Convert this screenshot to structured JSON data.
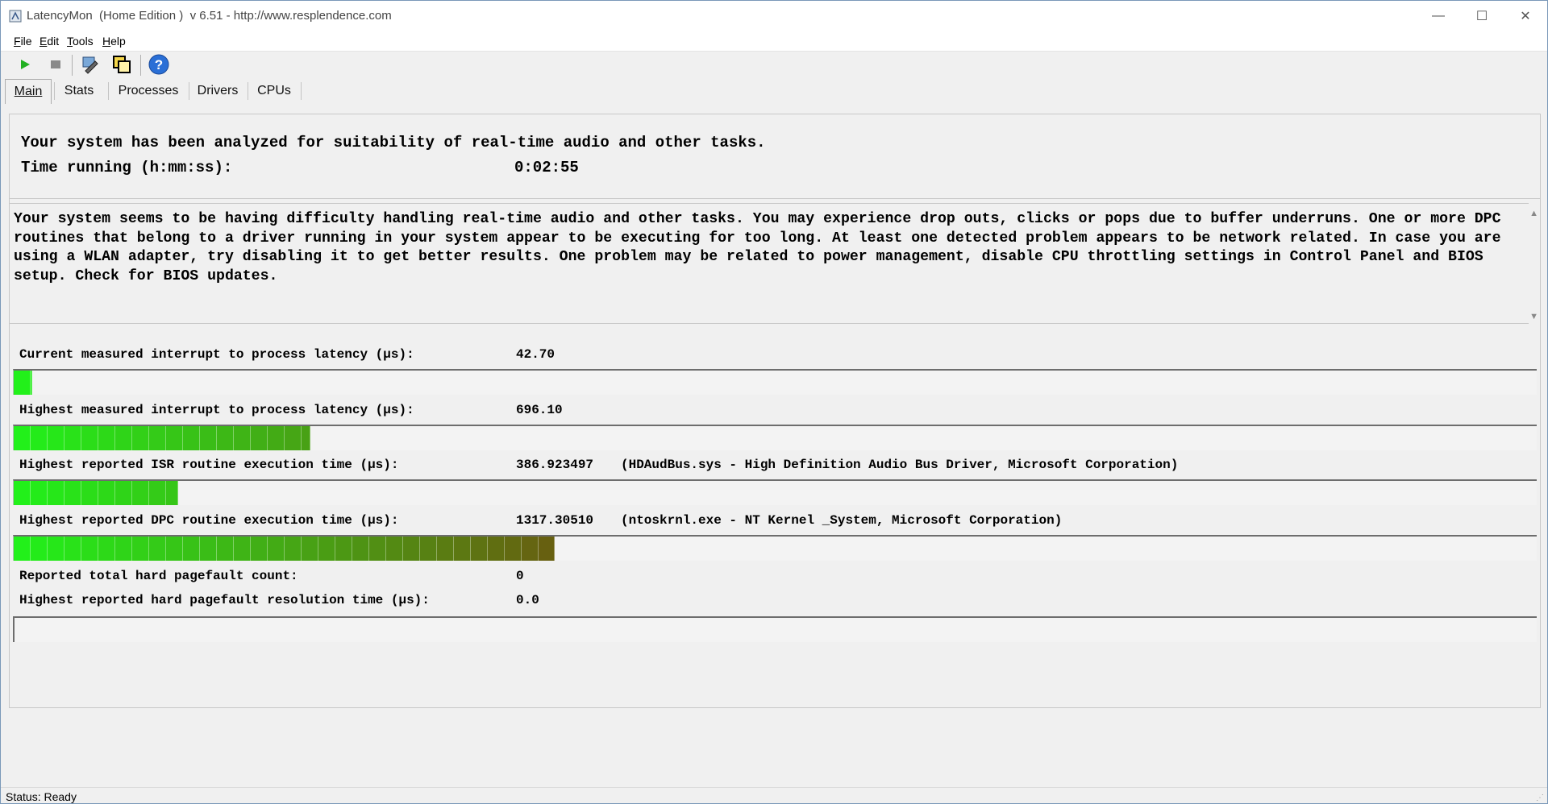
{
  "window": {
    "title": "LatencyMon  (Home Edition )  v 6.51 - http://www.resplendence.com",
    "controls": {
      "minimize": "—",
      "maximize": "☐",
      "close": "✕"
    }
  },
  "menu": {
    "items": [
      {
        "accel": "F",
        "rest": "ile"
      },
      {
        "accel": "E",
        "rest": "dit"
      },
      {
        "accel": "T",
        "rest": "ools"
      },
      {
        "accel": "H",
        "rest": "elp"
      }
    ]
  },
  "toolbar": {
    "icons": [
      "start-icon",
      "stop-icon",
      "wrench-icon",
      "windows-icon",
      "help-icon"
    ]
  },
  "tabs": [
    "Main",
    "Stats",
    "Processes",
    "Drivers",
    "CPUs"
  ],
  "summary": {
    "headline": "Your system has been analyzed for suitability of real-time audio and other tasks.",
    "time_label": "Time running (h:mm:ss):",
    "time_value": "0:02:55"
  },
  "message": "Your system seems to be having difficulty handling real-time audio and other tasks. You may experience drop outs, clicks or pops due to buffer underruns. One or more DPC routines that belong to a driver running in your system appear to be executing for too long. At least one detected problem appears to be network related. In case you are using a WLAN adapter, try disabling it to get better results. One problem may be related to power management, disable CPU throttling settings in Control Panel and BIOS setup. Check for BIOS updates.",
  "metrics": {
    "current_interrupt": {
      "label": "Current measured interrupt to process latency (µs):",
      "value": "42.70",
      "bar_fraction": 0.012
    },
    "highest_interrupt": {
      "label": "Highest measured interrupt to process latency (µs):",
      "value": "696.10",
      "bar_fraction": 0.195
    },
    "isr": {
      "label": "Highest reported ISR routine execution time (µs):",
      "value": "386.923497",
      "detail": "(HDAudBus.sys - High Definition Audio Bus Driver, Microsoft Corporation)",
      "bar_fraction": 0.108
    },
    "dpc": {
      "label": "Highest reported DPC routine execution time (µs):",
      "value": "1317.30510",
      "detail": "(ntoskrnl.exe - NT Kernel _System, Microsoft Corporation)",
      "bar_fraction": 0.355
    },
    "pagefault_count": {
      "label": "Reported total hard pagefault count:",
      "value": "0"
    },
    "pagefault_time": {
      "label": "Highest reported hard pagefault resolution time (µs):",
      "value": "0.0",
      "bar_fraction": 0
    }
  },
  "status": "Status: Ready",
  "colors": {
    "bar_start": "#22f01a",
    "bar_end": "#6a5a10"
  }
}
